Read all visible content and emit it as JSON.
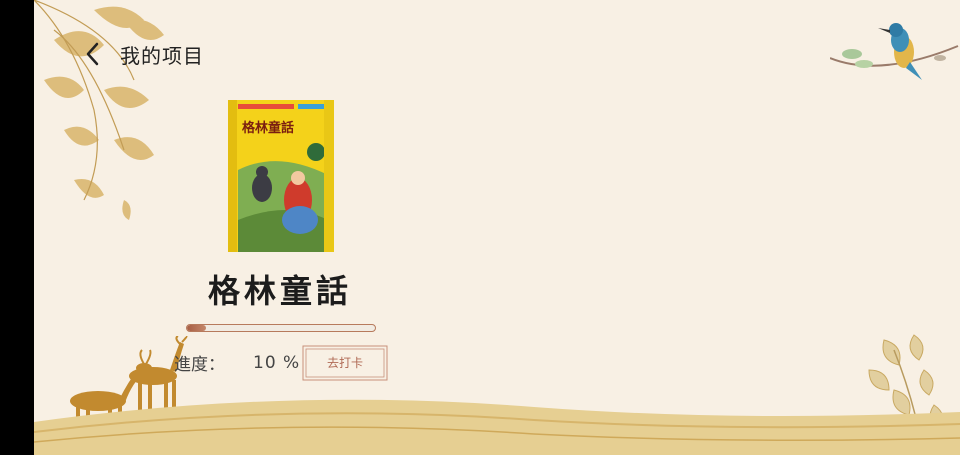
{
  "header": {
    "title": "我的项目",
    "back_icon": "chevron-left-icon"
  },
  "project": {
    "cover_title": "格林童話",
    "title": "格林童話",
    "progress_label": "進度：",
    "progress_value": "10 %",
    "progress_fraction": 0.1,
    "checkin_label": "去打卡"
  },
  "colors": {
    "background": "#f8f0e4",
    "accent": "#b06a55",
    "cover_yellow": "#f4d21a"
  }
}
